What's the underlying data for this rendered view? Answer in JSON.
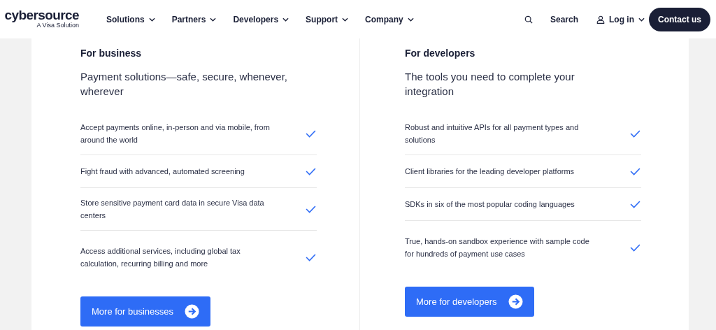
{
  "header": {
    "logo": "cybersource",
    "logo_tagline": "A Visa Solution",
    "nav": [
      {
        "label": "Solutions"
      },
      {
        "label": "Partners"
      },
      {
        "label": "Developers"
      },
      {
        "label": "Support"
      },
      {
        "label": "Company"
      }
    ],
    "search": "Search",
    "login": "Log in",
    "cta": "Contact us"
  },
  "columns": [
    {
      "heading": "For business",
      "subtitle": "Payment solutions—safe, secure, whenever, wherever",
      "items": [
        "Accept payments online, in-person and via mobile, from around the world",
        "Fight fraud with advanced, automated screening",
        "Store sensitive payment card data in secure Visa data centers",
        "Access additional services, including global tax calculation, recurring billing and more"
      ],
      "button": "More for businesses"
    },
    {
      "heading": "For developers",
      "subtitle": "The tools you need to complete your integration",
      "items": [
        "Robust and intuitive APIs for all payment types and solutions",
        "Client libraries for the leading developer platforms",
        "SDKs in six of the most popular coding languages",
        "True, hands-on sandbox experience with sample code for hundreds of payment use cases"
      ],
      "button": "More for developers"
    }
  ]
}
